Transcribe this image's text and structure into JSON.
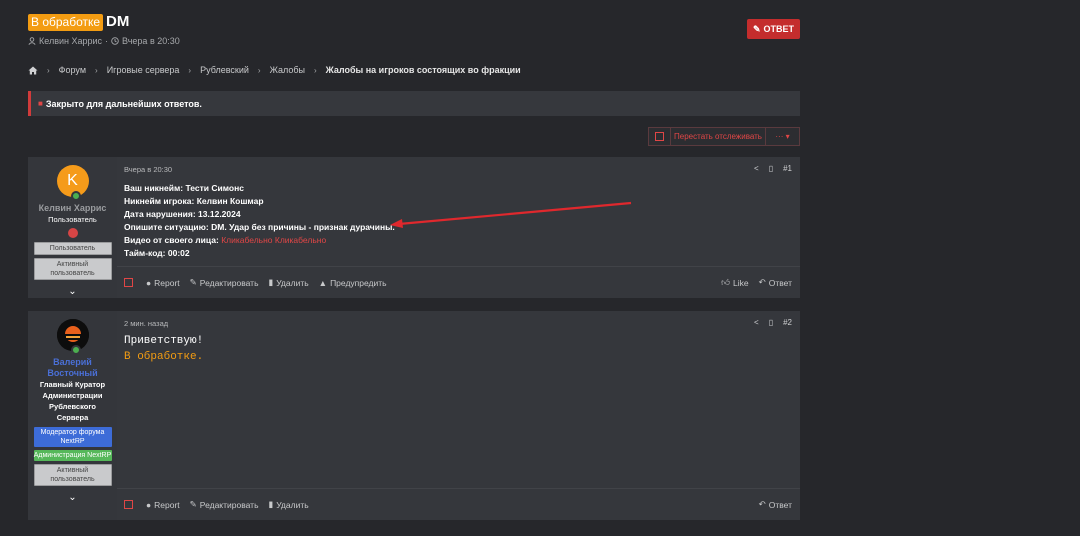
{
  "thread": {
    "status": "В обработке",
    "title": "DM",
    "author": "Келвин Харрис",
    "date": "Вчера в 20:30",
    "reply_label": "ОТВЕТ"
  },
  "breadcrumb": [
    "Форум",
    "Игровые сервера",
    "Рублевский",
    "Жалобы",
    "Жалобы на игроков состоящих во фракции"
  ],
  "notice": "Закрыто для дальнейших ответов.",
  "tracking": {
    "label": "Перестать отслеживать",
    "more": "··· ▾"
  },
  "posts": [
    {
      "author": "Келвин Харрис",
      "author_color": "#9a9c9f",
      "avatar_letter": "K",
      "title": "Пользователь",
      "badges": [
        "Пользователь",
        "Активный пользователь"
      ],
      "date": "Вчера в 20:30",
      "number": "#1",
      "lines": [
        {
          "label": "Ваш никнейм:",
          "value": "Тести Симонс"
        },
        {
          "label": "Никнейм игрока:",
          "value": "Келвин Кошмар"
        },
        {
          "label": "Дата нарушения:",
          "value": "13.12.2024"
        },
        {
          "label": "Опишите ситуацию:",
          "value": "DM. Удар без причины - признак дурачины."
        },
        {
          "label": "Видео от своего лица:",
          "value": "Кликабельно Кликабельно"
        },
        {
          "label": "Тайм-код:",
          "value": "00:02"
        }
      ],
      "actions": [
        "Report",
        "Редактировать",
        "Удалить",
        "Предупредить"
      ],
      "right_actions": [
        "Like",
        "Ответ"
      ]
    },
    {
      "author": "Валерий Восточный",
      "author_color": "#4a6fd6",
      "title": "Главный Куратор Администрации Рублевского Сервера",
      "badges": [
        "Модератор форума NextRP",
        "Администрация NextRP",
        "Активный пользователь"
      ],
      "badge_colors": [
        "blue",
        "green",
        "grey"
      ],
      "date": "2 мин. назад",
      "number": "#2",
      "greeting": "Приветствую!",
      "status_text": "В обработке.",
      "status_color": "#f39c12",
      "actions": [
        "Report",
        "Редактировать",
        "Удалить"
      ],
      "right_actions": [
        "Ответ"
      ]
    }
  ],
  "colors": {
    "accent": "#c42d2d",
    "badge": "#f39c12",
    "link": "#e04646"
  }
}
